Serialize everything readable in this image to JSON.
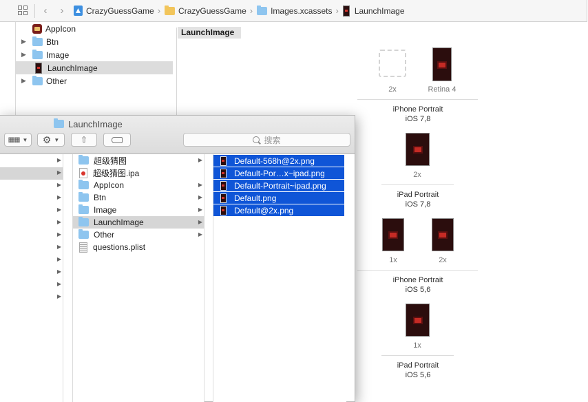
{
  "jumpbar": {
    "crumbs": [
      "CrazyGuessGame",
      "CrazyGuessGame",
      "Images.xcassets",
      "LaunchImage"
    ]
  },
  "outline": {
    "items": [
      {
        "label": "AppIcon",
        "kind": "appicon",
        "expandable": false,
        "selected": false
      },
      {
        "label": "Btn",
        "kind": "folder",
        "expandable": true,
        "selected": false
      },
      {
        "label": "Image",
        "kind": "folder",
        "expandable": true,
        "selected": false
      },
      {
        "label": "LaunchImage",
        "kind": "launchimage",
        "expandable": false,
        "selected": true
      },
      {
        "label": "Other",
        "kind": "folder",
        "expandable": true,
        "selected": false
      }
    ]
  },
  "editor": {
    "title": "LaunchImage",
    "slots": {
      "iphone_portrait_ios78": {
        "label_2x": "2x",
        "label_retina4": "Retina 4",
        "title": "iPhone Portrait",
        "subtitle": "iOS 7,8"
      },
      "ipad_portrait_ios78": {
        "label_2x": "2x",
        "title": "iPad Portrait",
        "subtitle": "iOS 7,8"
      },
      "iphone_portrait_ios56": {
        "label_1x": "1x",
        "label_2x": "2x",
        "title": "iPhone Portrait",
        "subtitle": "iOS 5,6"
      },
      "ipad_portrait_ios56": {
        "label_1x": "1x",
        "title": "iPad Portrait",
        "subtitle": "iOS 5,6"
      }
    }
  },
  "finder": {
    "title": "LaunchImage",
    "search_placeholder": "搜索",
    "folder_items": [
      {
        "label": "超级猜图",
        "kind": "folder",
        "has_arrow": true,
        "selected": false
      },
      {
        "label": "超级猜图.ipa",
        "kind": "ipa",
        "has_arrow": false,
        "selected": false
      },
      {
        "label": "AppIcon",
        "kind": "folder",
        "has_arrow": true,
        "selected": false
      },
      {
        "label": "Btn",
        "kind": "folder",
        "has_arrow": true,
        "selected": false
      },
      {
        "label": "Image",
        "kind": "folder",
        "has_arrow": true,
        "selected": false
      },
      {
        "label": "LaunchImage",
        "kind": "folder",
        "has_arrow": true,
        "selected": true
      },
      {
        "label": "Other",
        "kind": "folder",
        "has_arrow": true,
        "selected": false
      },
      {
        "label": "questions.plist",
        "kind": "plist",
        "has_arrow": false,
        "selected": false
      }
    ],
    "files": [
      {
        "label": "Default-568h@2x.png"
      },
      {
        "label": "Default-Por…x~ipad.png"
      },
      {
        "label": "Default-Portrait~ipad.png"
      },
      {
        "label": "Default.png"
      },
      {
        "label": "Default@2x.png"
      }
    ]
  },
  "colors": {
    "selection_blue": "#0f55d7",
    "folder_blue": "#8ec5ef",
    "folder_yellow": "#f2c55b"
  }
}
